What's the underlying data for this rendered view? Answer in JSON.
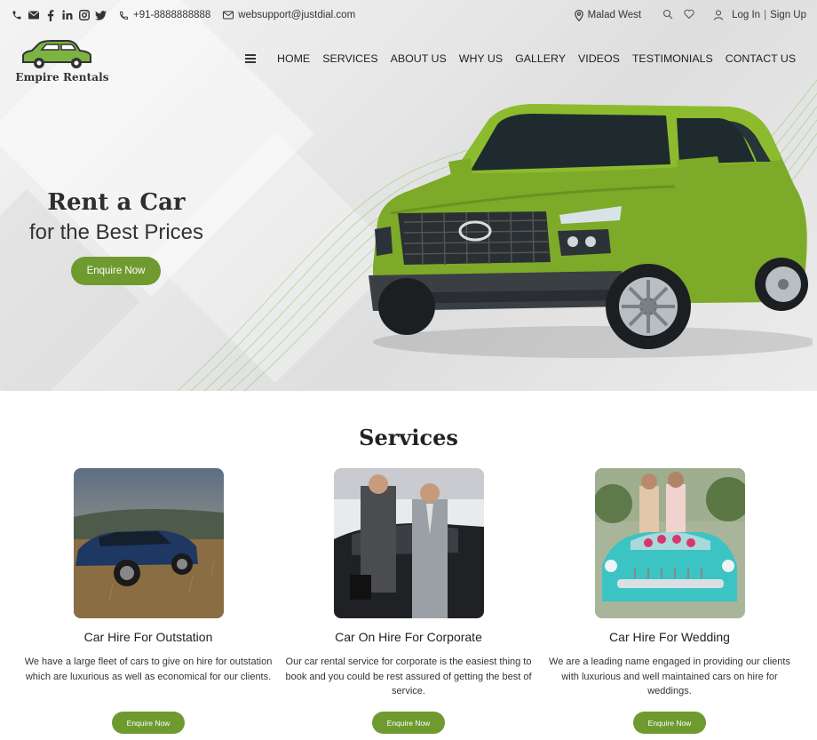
{
  "topbar": {
    "phone": "+91-8888888888",
    "email": "websupport@justdial.com",
    "location": "Malad West",
    "login": "Log In",
    "signup": "Sign Up"
  },
  "brand": {
    "name": "Empire Rentals",
    "accent": "#6f9a2f",
    "logo_color": "#7cb342"
  },
  "nav": {
    "items": [
      "HOME",
      "SERVICES",
      "ABOUT US",
      "WHY US",
      "GALLERY",
      "VIDEOS",
      "TESTIMONIALS",
      "CONTACT US"
    ]
  },
  "hero": {
    "title": "Rent a Car",
    "subtitle": "for the Best Prices",
    "cta": "Enquire Now"
  },
  "services": {
    "title": "Services",
    "cards": [
      {
        "title": "Car Hire For Outstation",
        "desc": "We have a large fleet of cars to give on hire for outstation which are luxurious as well as economical for our clients.",
        "cta": "Enquire Now"
      },
      {
        "title": "Car On Hire For Corporate",
        "desc": "Our car rental service for corporate is the easiest thing to book and you could be rest assured of getting the best of service.",
        "cta": "Enquire Now"
      },
      {
        "title": "Car Hire For Wedding",
        "desc": "We are a leading name engaged in providing our clients with luxurious and well maintained cars on hire for weddings.",
        "cta": "Enquire Now"
      }
    ]
  }
}
